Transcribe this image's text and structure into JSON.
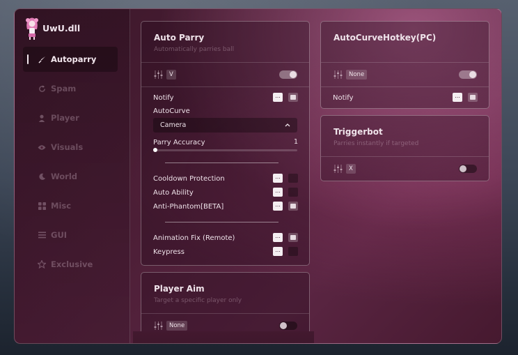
{
  "app": {
    "title": "UwU.dll"
  },
  "nav": [
    {
      "label": "Autoparry",
      "icon": "sword-icon",
      "active": true
    },
    {
      "label": "Spam",
      "icon": "refresh-icon",
      "active": false
    },
    {
      "label": "Player",
      "icon": "user-icon",
      "active": false
    },
    {
      "label": "Visuals",
      "icon": "eye-icon",
      "active": false
    },
    {
      "label": "World",
      "icon": "moon-icon",
      "active": false
    },
    {
      "label": "Misc",
      "icon": "grid-icon",
      "active": false
    },
    {
      "label": "GUI",
      "icon": "menu-icon",
      "active": false
    },
    {
      "label": "Exclusive",
      "icon": "star-icon",
      "active": false
    }
  ],
  "auto_parry": {
    "title": "Auto Parry",
    "subtitle": "Automatically parries ball",
    "keybind": "V",
    "enabled": true,
    "notify_label": "Notify",
    "notify_checked": true,
    "autocurve_label": "AutoCurve",
    "autocurve_value": "Camera",
    "accuracy_label": "Parry Accuracy",
    "accuracy_value": "1",
    "accuracy_fraction": 0.0,
    "options_group1": [
      {
        "label": "Cooldown Protection",
        "checked": false
      },
      {
        "label": "Auto Ability",
        "checked": false
      },
      {
        "label": "Anti-Phantom[BETA]",
        "checked": true
      }
    ],
    "options_group2": [
      {
        "label": "Animation Fix (Remote)",
        "checked": true
      },
      {
        "label": "Keypress",
        "checked": false
      }
    ],
    "dots_label": "..."
  },
  "player_aim": {
    "title": "Player Aim",
    "subtitle": "Target a specific player only",
    "keybind": "None",
    "enabled": false
  },
  "auto_curve_hotkey": {
    "title": "AutoCurveHotkey(PC)",
    "keybind": "None",
    "enabled": true,
    "notify_label": "Notify",
    "notify_checked": true,
    "dots_label": "..."
  },
  "triggerbot": {
    "title": "Triggerbot",
    "subtitle": "Parries instantly if targeted",
    "keybind": "X",
    "enabled": false
  }
}
